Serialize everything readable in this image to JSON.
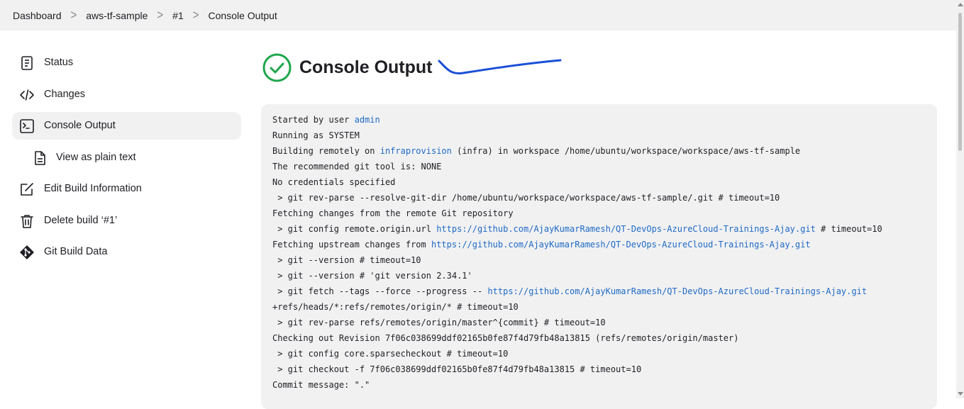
{
  "breadcrumb": {
    "items": [
      "Dashboard",
      "aws-tf-sample",
      "#1",
      "Console Output"
    ],
    "separator": ">"
  },
  "sidebar": {
    "items": [
      {
        "label": "Status",
        "icon": "document-icon"
      },
      {
        "label": "Changes",
        "icon": "code-icon"
      },
      {
        "label": "Console Output",
        "icon": "terminal-icon"
      },
      {
        "label": "View as plain text",
        "icon": "file-text-icon"
      },
      {
        "label": "Edit Build Information",
        "icon": "edit-icon"
      },
      {
        "label": "Delete build ‘#1’",
        "icon": "trash-icon"
      },
      {
        "label": "Git Build Data",
        "icon": "git-icon"
      }
    ]
  },
  "main": {
    "title": "Console Output",
    "status_color": "#1ea64b",
    "link_color": "#1f6ac4"
  },
  "console": {
    "l1_pre": "Started by user ",
    "l1_link": "admin",
    "l2": "Running as SYSTEM",
    "l3_pre": "Building remotely on ",
    "l3_link": "infraprovision",
    "l3_post": " (infra) in workspace /home/ubuntu/workspace/workspace/aws-tf-sample",
    "l4": "The recommended git tool is: NONE",
    "l5": "No credentials specified",
    "l6": " > git rev-parse --resolve-git-dir /home/ubuntu/workspace/workspace/aws-tf-sample/.git # timeout=10",
    "l7": "Fetching changes from the remote Git repository",
    "l8_pre": " > git config remote.origin.url ",
    "l8_link": "https://github.com/AjayKumarRamesh/QT-DevOps-AzureCloud-Trainings-Ajay.git",
    "l8_post": " # timeout=10",
    "l9_pre": "Fetching upstream changes from ",
    "l9_link": "https://github.com/AjayKumarRamesh/QT-DevOps-AzureCloud-Trainings-Ajay.git",
    "l10": " > git --version # timeout=10",
    "l11": " > git --version # 'git version 2.34.1'",
    "l12_pre": " > git fetch --tags --force --progress -- ",
    "l12_link": "https://github.com/AjayKumarRamesh/QT-DevOps-AzureCloud-Trainings-Ajay.git",
    "l13": "+refs/heads/*:refs/remotes/origin/* # timeout=10",
    "l14": " > git rev-parse refs/remotes/origin/master^{commit} # timeout=10",
    "l15": "Checking out Revision 7f06c038699ddf02165b0fe87f4d79fb48a13815 (refs/remotes/origin/master)",
    "l16": " > git config core.sparsecheckout # timeout=10",
    "l17": " > git checkout -f 7f06c038699ddf02165b0fe87f4d79fb48a13815 # timeout=10",
    "l18": "Commit message: \".\""
  }
}
